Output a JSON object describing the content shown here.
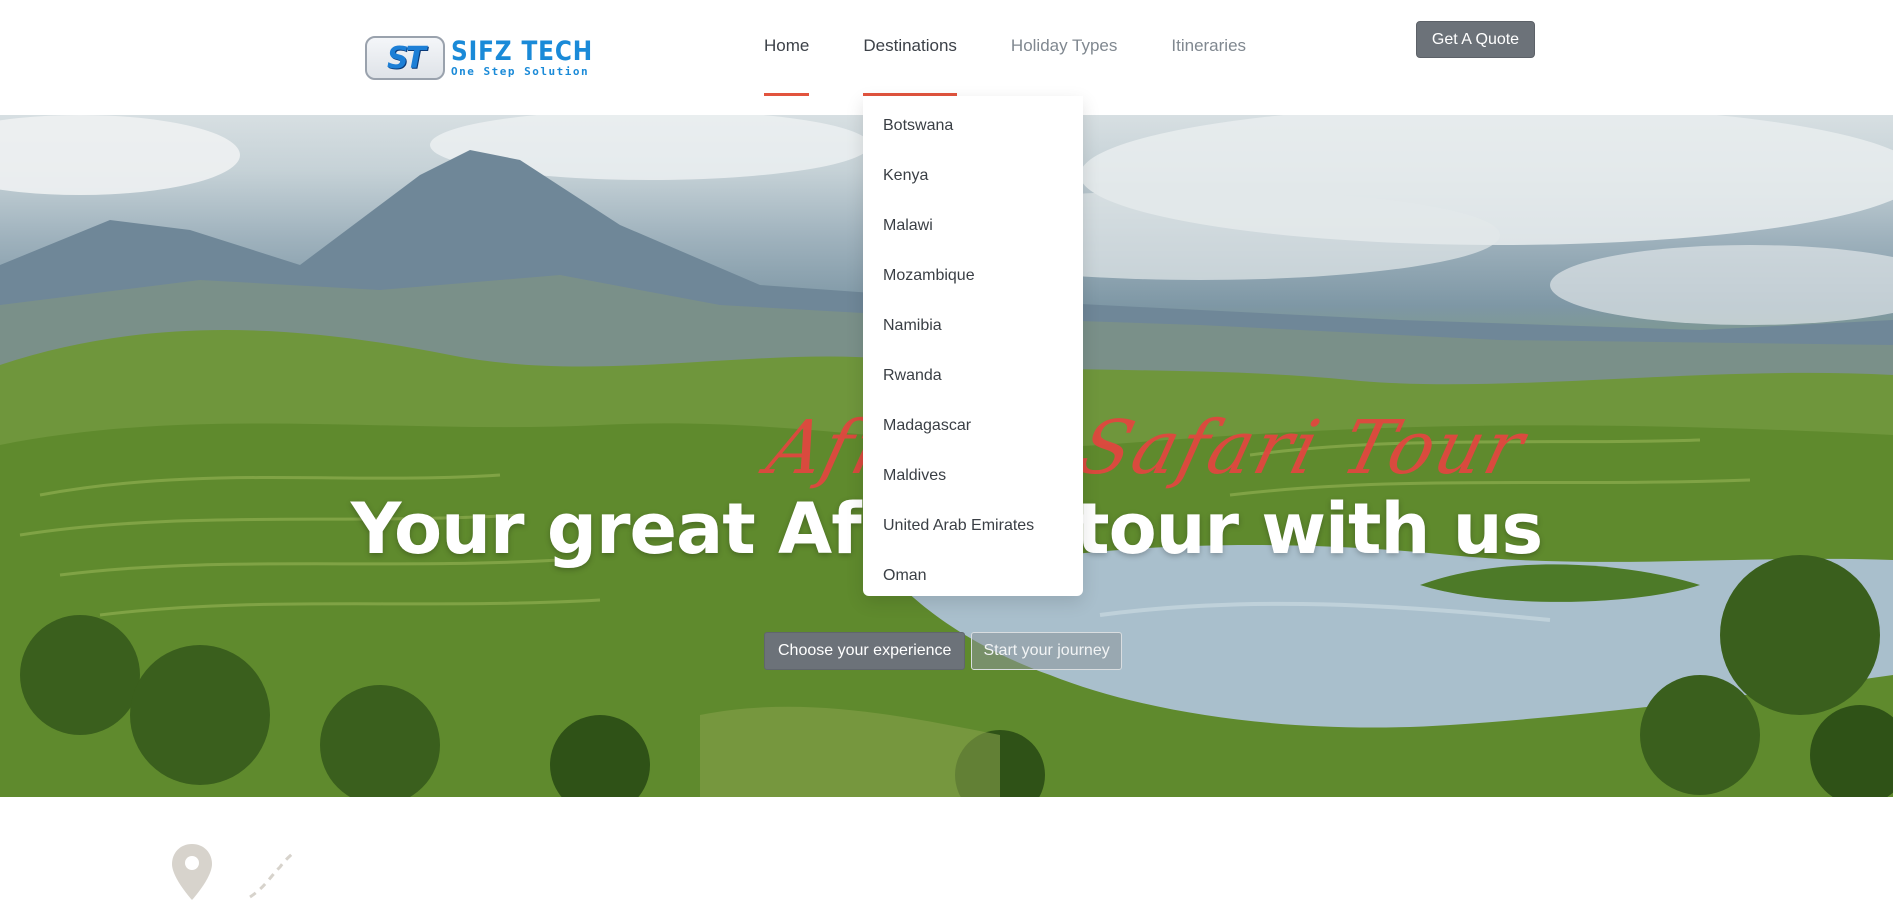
{
  "header": {
    "logo": {
      "badge": "ST",
      "name": "SIFZ TECH",
      "tagline": "One Step Solution"
    },
    "nav": [
      {
        "label": "Home",
        "active": true
      },
      {
        "label": "Destinations",
        "active": true,
        "open": true
      },
      {
        "label": "Holiday Types",
        "active": false
      },
      {
        "label": "Itineraries",
        "active": false
      }
    ],
    "quote_button": "Get A Quote"
  },
  "dropdown": {
    "items": [
      "Botswana",
      "Kenya",
      "Malawi",
      "Mozambique",
      "Namibia",
      "Rwanda",
      "Madagascar",
      "Maldives",
      "United Arab Emirates",
      "Oman"
    ]
  },
  "hero": {
    "script_text": "African Safari Tour",
    "headline": "Your great African tour with us",
    "primary_button": "Choose your experience",
    "secondary_button": "Start your journey"
  },
  "colors": {
    "accent": "#e2543e",
    "button_gray": "#6c7279",
    "logo_blue": "#1a8ad8"
  },
  "icons": [
    "map-pin-icon",
    "route-icon"
  ]
}
